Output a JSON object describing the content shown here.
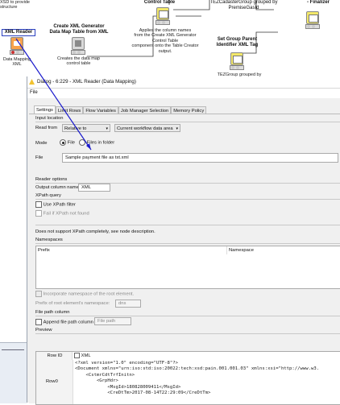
{
  "canvas": {
    "top_left_text": "XSD to provide\nstructure",
    "xml_reader": {
      "title": "XML Reader",
      "desc": "Data Mapping\nXML"
    },
    "xml_generator": {
      "title": "Create XML Generator\nData Map Table from XML",
      "desc": "Creates the data map\ncontrol table"
    },
    "control_table": {
      "title": "Control Table",
      "desc": "Applies the column names\nfrom the Create XML Generator\nControl Table\ncomponent onto the Table Creator\noutput."
    },
    "group_top": {
      "title": "TEZCadasterGroup grouped by\nPremiseGasId"
    },
    "set_group": {
      "title": "Set Group Parent\nIdentifier XML Tag",
      "desc": "TEZGroup grouped by"
    },
    "finalizer": {
      "title": "- Finalizer"
    }
  },
  "dialog": {
    "title": "Dialog - 6:229 - XML Reader (Data Mapping)",
    "menu": "File",
    "tabs": [
      "Settings",
      "Limit Rows",
      "Flow Variables",
      "Job Manager Selection",
      "Memory Policy"
    ],
    "active_tab": "Settings",
    "input_location": {
      "group_label": "Input location",
      "read_from_label": "Read from",
      "read_from_value": "Relative to",
      "relative_value": "Current workflow data area",
      "mode_label": "Mode",
      "mode_file": "File",
      "mode_folder": "Files in folder",
      "file_label": "File",
      "file_value": "Sample payment file as txt.xml"
    },
    "reader_options": {
      "group_label": "Reader options",
      "output_column_label": "Output column name",
      "output_column_value": "XML"
    },
    "xpath": {
      "group_label": "XPath query",
      "use_xpath": "Use XPath filter",
      "fail_if": "Fail if XPath not found",
      "note": "Does not support XPath completely, see node description."
    },
    "namespaces": {
      "group_label": "Namespaces",
      "col_prefix": "Prefix",
      "col_namespace": "Namespace",
      "incorporate": "Incorporate namespace of the root element.",
      "prefix_root_label": "Prefix of root element's namespace:",
      "prefix_root_value": "dns"
    },
    "file_path_column": {
      "group_label": "File path column",
      "append_label": "Append file path column",
      "placeholder": "File path"
    },
    "preview": {
      "group_label": "Preview",
      "col_row_id": "Row ID",
      "col_xml": "XML",
      "row_id": "Row0",
      "xml_lines": [
        "<?xml version=\"1.0\" encoding=\"UTF-8\"?>",
        "<Document xmlns=\"urn:iso:std:iso:20022:tech:xsd:pain.001.001.03\" xmlns:xsi=\"http://www.w3.",
        "    <CstmrCdtTrfInitn>",
        "        <GrpHdr>",
        "            <MsgId>180828009411</MsgId>",
        "            <CreDtTm>2017-08-14T22:29:09</CreDtTm>"
      ]
    }
  }
}
